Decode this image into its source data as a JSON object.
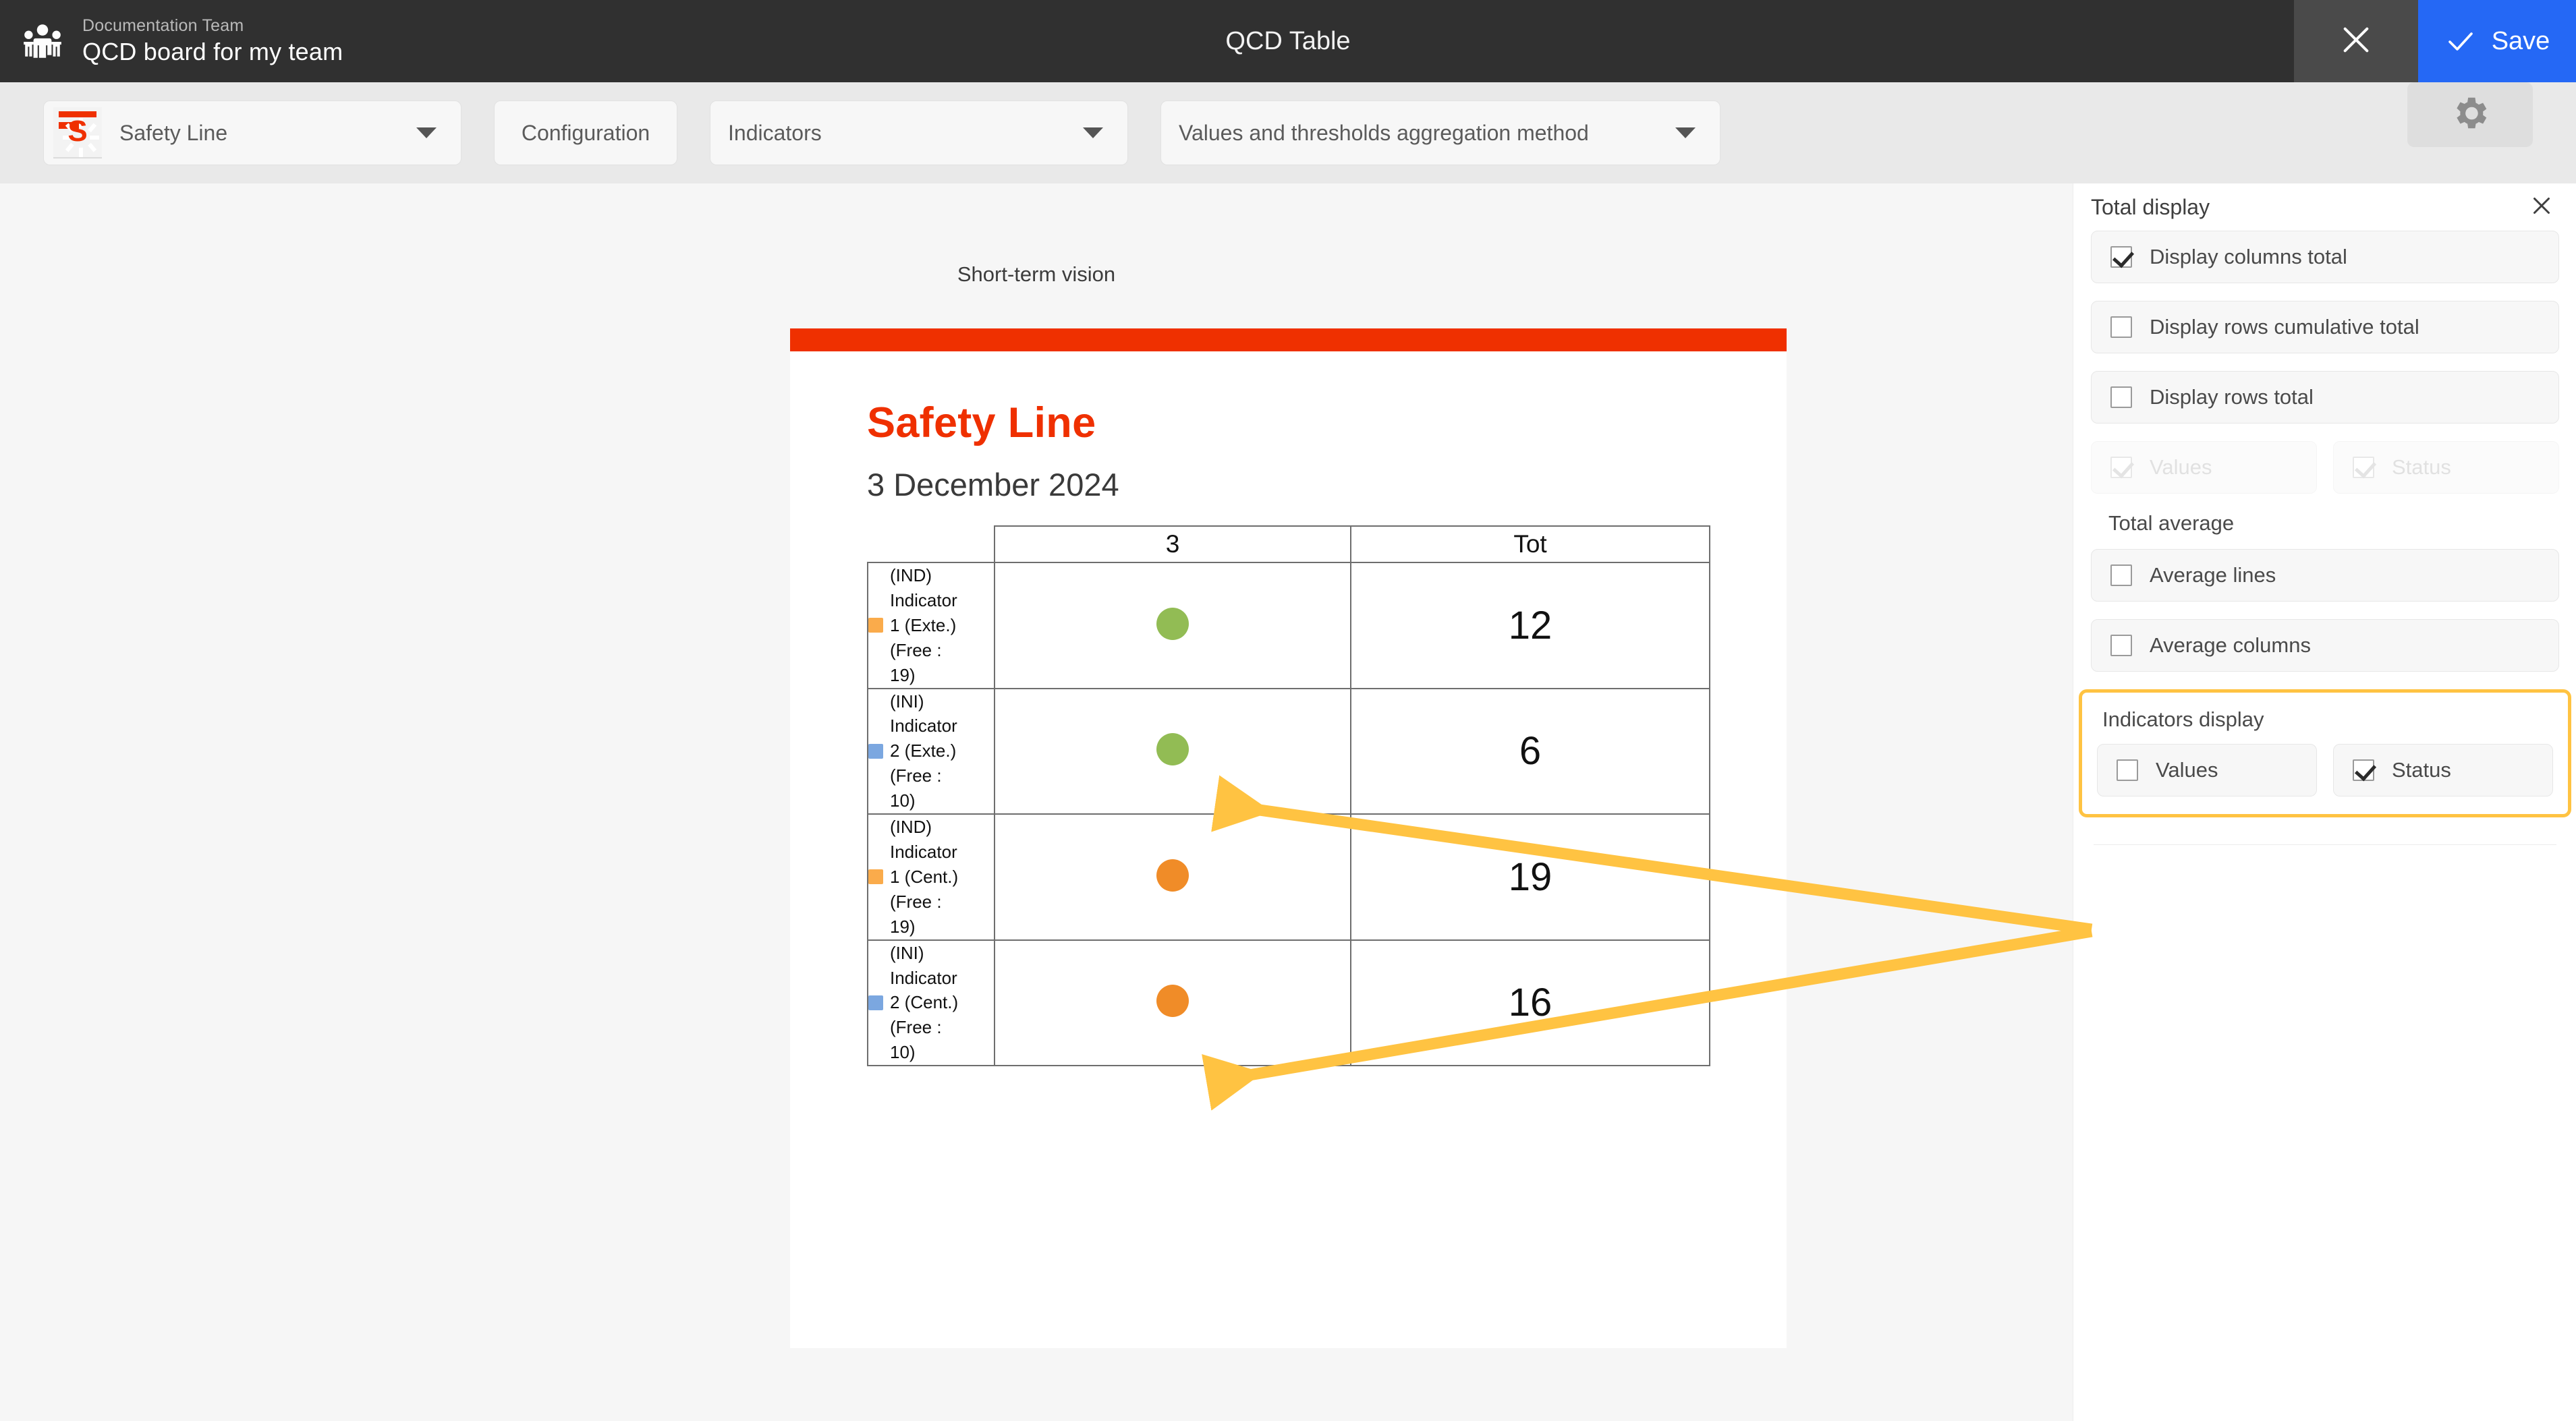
{
  "topbar": {
    "team_label": "Documentation Team",
    "board_name": "QCD board for my team",
    "window_title": "QCD Table",
    "team_icon": "people-group-icon",
    "close_icon": "close-icon",
    "save_icon": "check-icon",
    "save_label": "Save",
    "save_color": "#2568f5",
    "background": "#303030"
  },
  "toolbar": {
    "project_name": "Safety Line",
    "project_thumb_letter": "S",
    "configuration_label": "Configuration",
    "indicators_label": "Indicators",
    "aggregation_label": "Values and thresholds aggregation method",
    "settings_icon": "gear-icon",
    "caret_icon": "chevron-down-icon"
  },
  "canvas": {
    "vision_label": "Short-term vision",
    "card": {
      "accent_color": "#ef3000",
      "title": "Safety Line",
      "date": "3 December 2024"
    }
  },
  "chart_data": {
    "type": "table",
    "title": "Safety Line",
    "subtitle": "3 December 2024",
    "columns": [
      "",
      "3",
      "Tot"
    ],
    "rows": [
      {
        "swatch_color": "#FAAB4B",
        "label_lines": [
          "(IND)",
          "Indicator",
          "1 (Exte.)",
          "(Free :",
          "19)"
        ],
        "status": "green",
        "status_color": "#92BC54",
        "total": "12"
      },
      {
        "swatch_color": "#7BA7E0",
        "label_lines": [
          "(INI)",
          "Indicator",
          "2 (Exte.)",
          "(Free :",
          "10)"
        ],
        "status": "green",
        "status_color": "#92BC54",
        "total": "6"
      },
      {
        "swatch_color": "#FAAB4B",
        "label_lines": [
          "(IND)",
          "Indicator",
          "1 (Cent.)",
          "(Free :",
          "19)"
        ],
        "status": "orange",
        "status_color": "#F08C28",
        "total": "19"
      },
      {
        "swatch_color": "#7BA7E0",
        "label_lines": [
          "(INI)",
          "Indicator",
          "2 (Cent.)",
          "(Free :",
          "10)"
        ],
        "status": "orange",
        "status_color": "#F08C28",
        "total": "16"
      }
    ]
  },
  "annotations": {
    "arrow_color": "#FFC342",
    "highlight_color": "#FFC342"
  },
  "panel": {
    "title": "Total display",
    "close_icon": "close-icon",
    "options": [
      {
        "label": "Display columns total",
        "checked": true,
        "disabled": false
      },
      {
        "label": "Display rows cumulative total",
        "checked": false,
        "disabled": false
      },
      {
        "label": "Display rows total",
        "checked": false,
        "disabled": false
      }
    ],
    "total_display_pair": [
      {
        "label": "Values",
        "checked": true,
        "disabled": true
      },
      {
        "label": "Status",
        "checked": true,
        "disabled": true
      }
    ],
    "total_average": {
      "section_label": "Total average",
      "options": [
        {
          "label": "Average lines",
          "checked": false,
          "disabled": false
        },
        {
          "label": "Average columns",
          "checked": false,
          "disabled": false
        }
      ]
    },
    "indicators_display": {
      "group_label": "Indicators display",
      "options": [
        {
          "label": "Values",
          "checked": false,
          "disabled": false
        },
        {
          "label": "Status",
          "checked": true,
          "disabled": false
        }
      ]
    }
  }
}
